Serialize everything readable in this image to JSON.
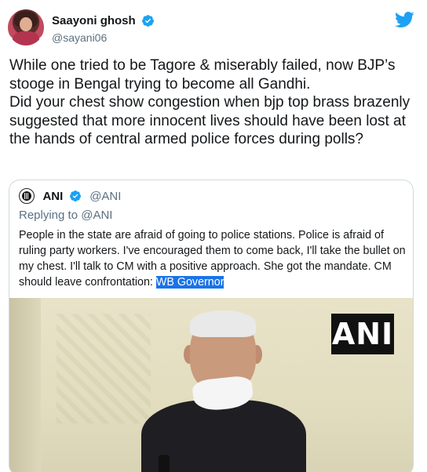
{
  "author": {
    "display_name": "Saayoni ghosh",
    "handle": "@sayani06",
    "verified_icon": "verified-badge-icon",
    "avatar_icon": "user-avatar"
  },
  "brand": {
    "logo_icon": "twitter-bird-icon",
    "accent_color": "#1da1f2"
  },
  "tweet": {
    "text": "While one tried to be Tagore & miserably failed, now BJP’s stooge in Bengal trying to become all Gandhi.\nDid your chest show congestion when bjp top brass brazenly suggested that more innocent lives should have been lost at the hands of central armed police forces during polls?"
  },
  "quoted_tweet": {
    "display_name": "ANI",
    "handle": "@ANI",
    "replying_to": "Replying to @ANI",
    "text": "People in the state are afraid of going to police stations. Police is afraid of ruling party workers. I've encouraged them to come back, I'll take the bullet on my chest. I'll talk to CM with a positive approach. She got the mandate. CM should leave confrontation: ",
    "highlighted_text": "WB Governor",
    "highlight_color": "#1a73e8",
    "image_watermark": "ANI"
  }
}
